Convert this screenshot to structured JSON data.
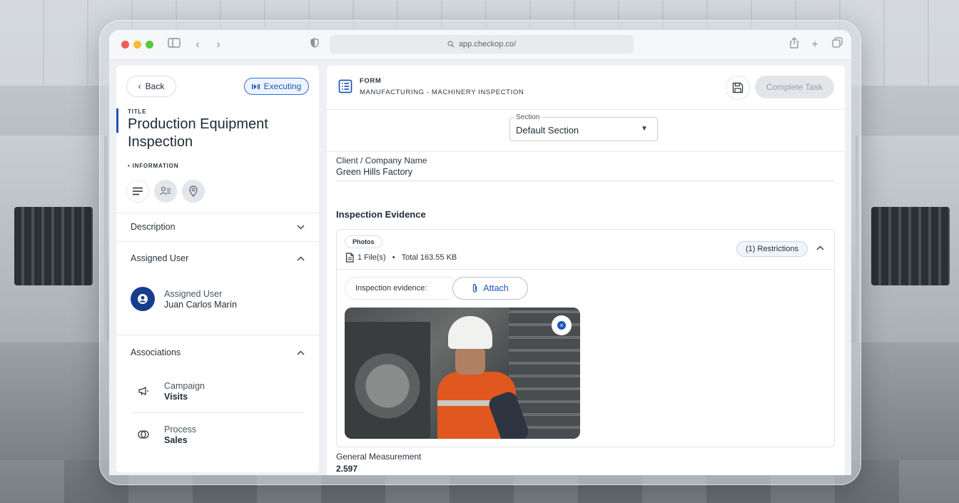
{
  "browser": {
    "url": "app.checkop.co/"
  },
  "left_panel": {
    "back_label": "Back",
    "status_label": "Executing",
    "title_label": "TITLE",
    "title": "Production Equipment Inspection",
    "information_label": "• INFORMATION",
    "description_label": "Description",
    "assigned_user_section": "Assigned User",
    "assigned_user_label": "Assigned User",
    "assigned_user_name": "Juan Carlos Marín",
    "associations_label": "Associations",
    "associations": [
      {
        "label": "Campaign",
        "value": "Visits",
        "icon": "megaphone-icon"
      },
      {
        "label": "Process",
        "value": "Sales",
        "icon": "process-icon"
      }
    ]
  },
  "right_panel": {
    "form_label": "FORM",
    "form_path": "MANUFACTURING - MACHINERY INSPECTION",
    "complete_label": "Complete Task",
    "section_legend": "Section",
    "section_value": "Default Section",
    "client_label": "Client / Company Name",
    "client_value": "Green Hills Factory",
    "evidence_title": "Inspection Evidence",
    "evidence_chip": "Photos",
    "file_count": "1 File(s)",
    "file_sep": "•",
    "file_total": "Total 163.55 KB",
    "restrictions_label": "(1) Restrictions",
    "evidence_field_label": "Inspection evidence:",
    "attach_label": "Attach",
    "measurement_label": "General Measurement",
    "measurement_value": "2.597"
  },
  "colors": {
    "accent": "#1d57b8",
    "avatar": "#163d8c",
    "disabled_button": "#e3e5e8"
  }
}
